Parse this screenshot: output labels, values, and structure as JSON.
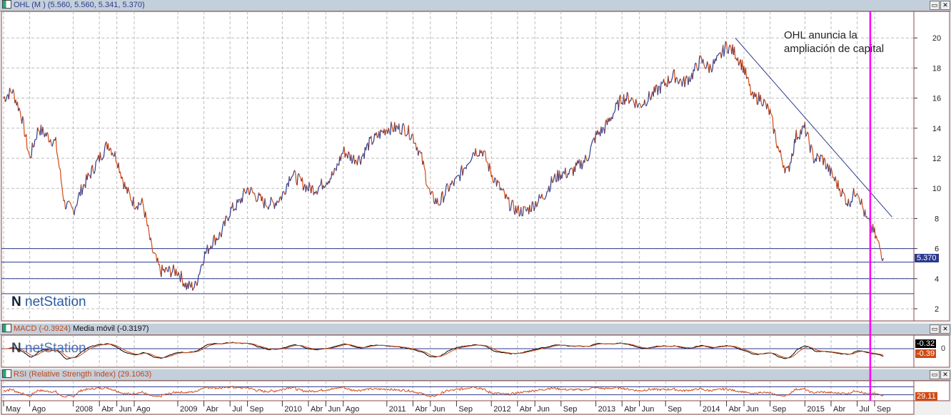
{
  "main": {
    "title": "OHL (M ) (5.560, 5.560, 5.341, 5.370)",
    "annotation": [
      "OHL anuncia la",
      "ampliación de capital"
    ],
    "last_price_label": "5.370",
    "logo": "netStation"
  },
  "macd": {
    "title": "MACD (-0.3924)",
    "ma_title": "Media móvil (-0.3197)",
    "value_black": "-0.32",
    "value_red": "-0.39",
    "zero_label": "0"
  },
  "rsi": {
    "title": "RSI (Relative Strength Index) (29.1063)",
    "value": "29.11"
  },
  "colors": {
    "up": "#2b3a8c",
    "down": "#d04a14",
    "event": "#ff00ff",
    "trend": "#2b3a8c"
  },
  "chart_data": {
    "type": "line",
    "title": "OHL (M)",
    "start": "2007-05",
    "frequency": "monthly",
    "values": [
      16,
      16.5,
      15,
      12,
      14,
      13.5,
      13,
      9,
      8.5,
      10,
      11,
      12,
      13,
      12,
      10,
      9,
      9,
      6,
      4.5,
      4.5,
      4.5,
      3.5,
      3.5,
      5.5,
      6.5,
      7,
      8.5,
      9,
      10,
      9.5,
      9,
      9,
      9.5,
      11,
      10.5,
      10,
      10,
      10.5,
      11,
      12.5,
      12,
      12,
      13,
      13.5,
      14,
      14,
      14,
      13.5,
      12,
      9.5,
      9,
      10,
      10.5,
      11.5,
      12.5,
      12.5,
      11,
      10,
      9,
      8.5,
      8.5,
      9,
      9.5,
      10.5,
      11,
      11,
      11.5,
      12,
      13.5,
      14,
      15,
      16,
      16,
      15.5,
      16,
      16.5,
      17,
      17.5,
      17,
      17.5,
      18.5,
      18,
      18.5,
      19.5,
      19,
      18,
      16,
      16,
      15,
      12.5,
      11,
      13.5,
      14,
      12,
      12,
      11,
      10,
      9,
      10,
      8,
      7,
      5.37
    ],
    "yticks": [
      2,
      4,
      6,
      8,
      10,
      12,
      14,
      16,
      18,
      20
    ],
    "ylim": [
      1,
      21.3
    ],
    "horizontal_levels": [
      6,
      5.1,
      4,
      3
    ],
    "trendline": {
      "from": {
        "month_index": 84,
        "value": 20
      },
      "to": {
        "month_index": 102,
        "value": 8.1
      }
    },
    "event_month_index": 99.5,
    "xticks": [
      {
        "label": "May",
        "i": 0
      },
      {
        "label": "Ago",
        "i": 3
      },
      {
        "label": "2008",
        "i": 8
      },
      {
        "label": "Abr",
        "i": 11
      },
      {
        "label": "Jun",
        "i": 13
      },
      {
        "label": "Ago",
        "i": 15
      },
      {
        "label": "2009",
        "i": 20
      },
      {
        "label": "Abr",
        "i": 23
      },
      {
        "label": "Jul",
        "i": 26
      },
      {
        "label": "Sep",
        "i": 28
      },
      {
        "label": "2010",
        "i": 32
      },
      {
        "label": "Abr",
        "i": 35
      },
      {
        "label": "Jun",
        "i": 37
      },
      {
        "label": "Ago",
        "i": 39
      },
      {
        "label": "2011",
        "i": 44
      },
      {
        "label": "Abr",
        "i": 47
      },
      {
        "label": "Jun",
        "i": 49
      },
      {
        "label": "Sep",
        "i": 52
      },
      {
        "label": "2012",
        "i": 56
      },
      {
        "label": "Abr",
        "i": 59
      },
      {
        "label": "Jun",
        "i": 61
      },
      {
        "label": "Sep",
        "i": 64
      },
      {
        "label": "2013",
        "i": 68
      },
      {
        "label": "Abr",
        "i": 71
      },
      {
        "label": "Jun",
        "i": 73
      },
      {
        "label": "Sep",
        "i": 76
      },
      {
        "label": "2014",
        "i": 80
      },
      {
        "label": "Abr",
        "i": 83
      },
      {
        "label": "Jun",
        "i": 85
      },
      {
        "label": "Sep",
        "i": 88
      },
      {
        "label": "2015",
        "i": 92
      },
      {
        "label": "Abr",
        "i": 95
      },
      {
        "label": "Jul",
        "i": 98
      },
      {
        "label": "Sep",
        "i": 100
      }
    ]
  }
}
